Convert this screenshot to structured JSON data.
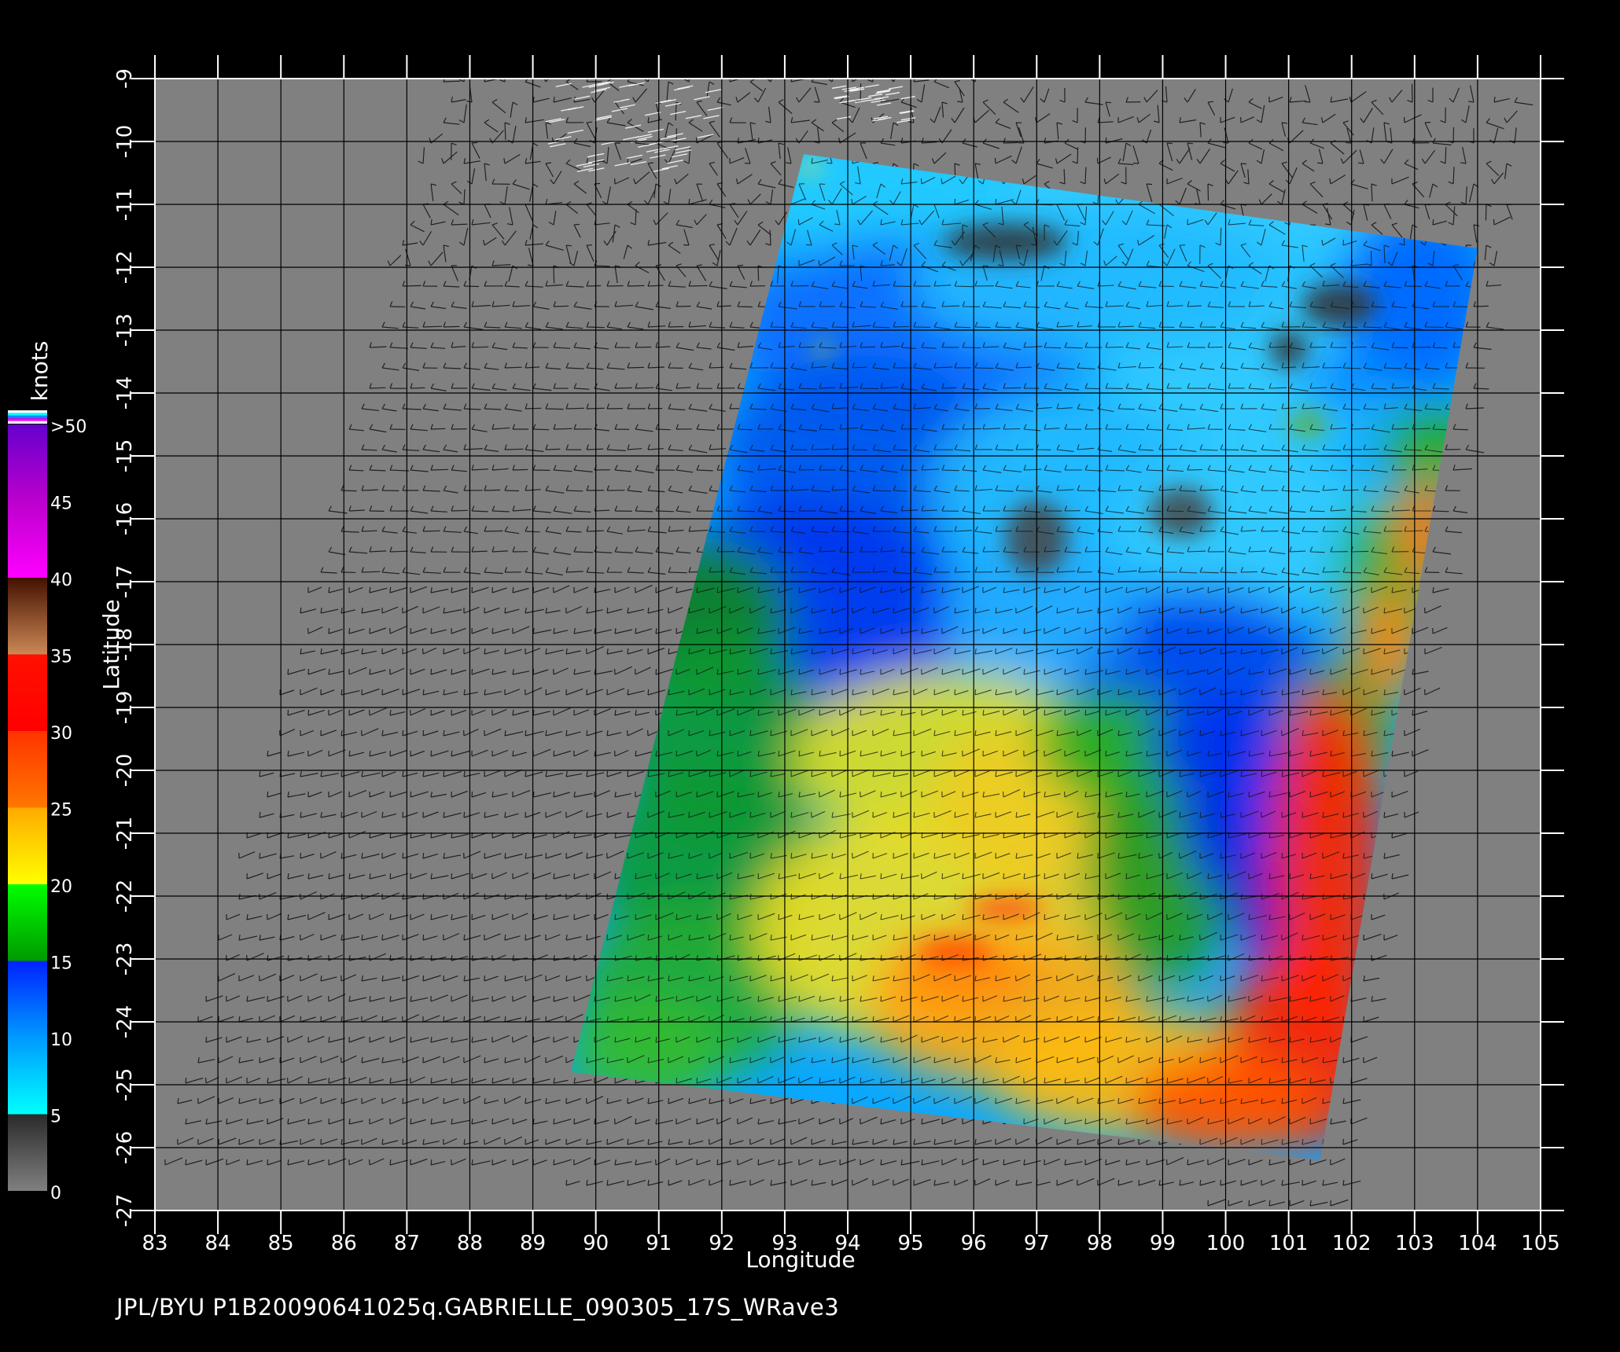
{
  "footer": {
    "text": "JPL/BYU  P1B20090641025q.GABRIELLE_090305_17S_WRave3"
  },
  "axes": {
    "xlabel": "Longitude",
    "ylabel": "Latitude",
    "xlim": [
      83,
      105
    ],
    "ylim": [
      -27,
      -9
    ],
    "xticks": [
      "83",
      "84",
      "85",
      "86",
      "87",
      "88",
      "89",
      "90",
      "91",
      "92",
      "93",
      "94",
      "95",
      "96",
      "97",
      "98",
      "99",
      "100",
      "101",
      "102",
      "103",
      "104",
      "105"
    ],
    "yticks": [
      "-9",
      "-10",
      "-11",
      "-12",
      "-13",
      "-14",
      "-15",
      "-16",
      "-17",
      "-18",
      "-19",
      "-20",
      "-21",
      "-22",
      "-23",
      "-24",
      "-25",
      "-26",
      "-27"
    ]
  },
  "colorbar": {
    "unit": "knots",
    "labels": [
      "0",
      "5",
      "10",
      "15",
      "20",
      "25",
      "30",
      "35",
      "40",
      "45",
      ">50"
    ],
    "stops": [
      {
        "v": 0,
        "color": "#808080"
      },
      {
        "v": 5,
        "color": "#2a2a2a"
      },
      {
        "v": 5,
        "color": "#00ffff"
      },
      {
        "v": 10,
        "color": "#0099ff"
      },
      {
        "v": 15,
        "color": "#0022ff"
      },
      {
        "v": 15,
        "color": "#009900"
      },
      {
        "v": 20,
        "color": "#00ff00"
      },
      {
        "v": 20,
        "color": "#ffff00"
      },
      {
        "v": 25,
        "color": "#ffaa00"
      },
      {
        "v": 25,
        "color": "#ff7700"
      },
      {
        "v": 30,
        "color": "#ff3300"
      },
      {
        "v": 30,
        "color": "#ff0000"
      },
      {
        "v": 35,
        "color": "#ff1100"
      },
      {
        "v": 35,
        "color": "#cc8855"
      },
      {
        "v": 40,
        "color": "#441100"
      },
      {
        "v": 40,
        "color": "#ff00ff"
      },
      {
        "v": 45,
        "color": "#bb00cc"
      },
      {
        "v": 50,
        "color": "#6600cc"
      }
    ]
  },
  "swath": {
    "corners_lonlat": [
      [
        93.3,
        -10.2
      ],
      [
        104.0,
        -11.7
      ],
      [
        101.5,
        -26.2
      ],
      [
        89.6,
        -24.8
      ]
    ],
    "coverage_corners_lonlat": [
      [
        87.5,
        -9.0
      ],
      [
        104.8,
        -9.1
      ],
      [
        101.8,
        -27.0
      ],
      [
        83.0,
        -26.4
      ]
    ]
  },
  "colors": {
    "background": "#000000",
    "plot_background": "#808080",
    "grid": "#000000",
    "axis": "#ffffff"
  }
}
